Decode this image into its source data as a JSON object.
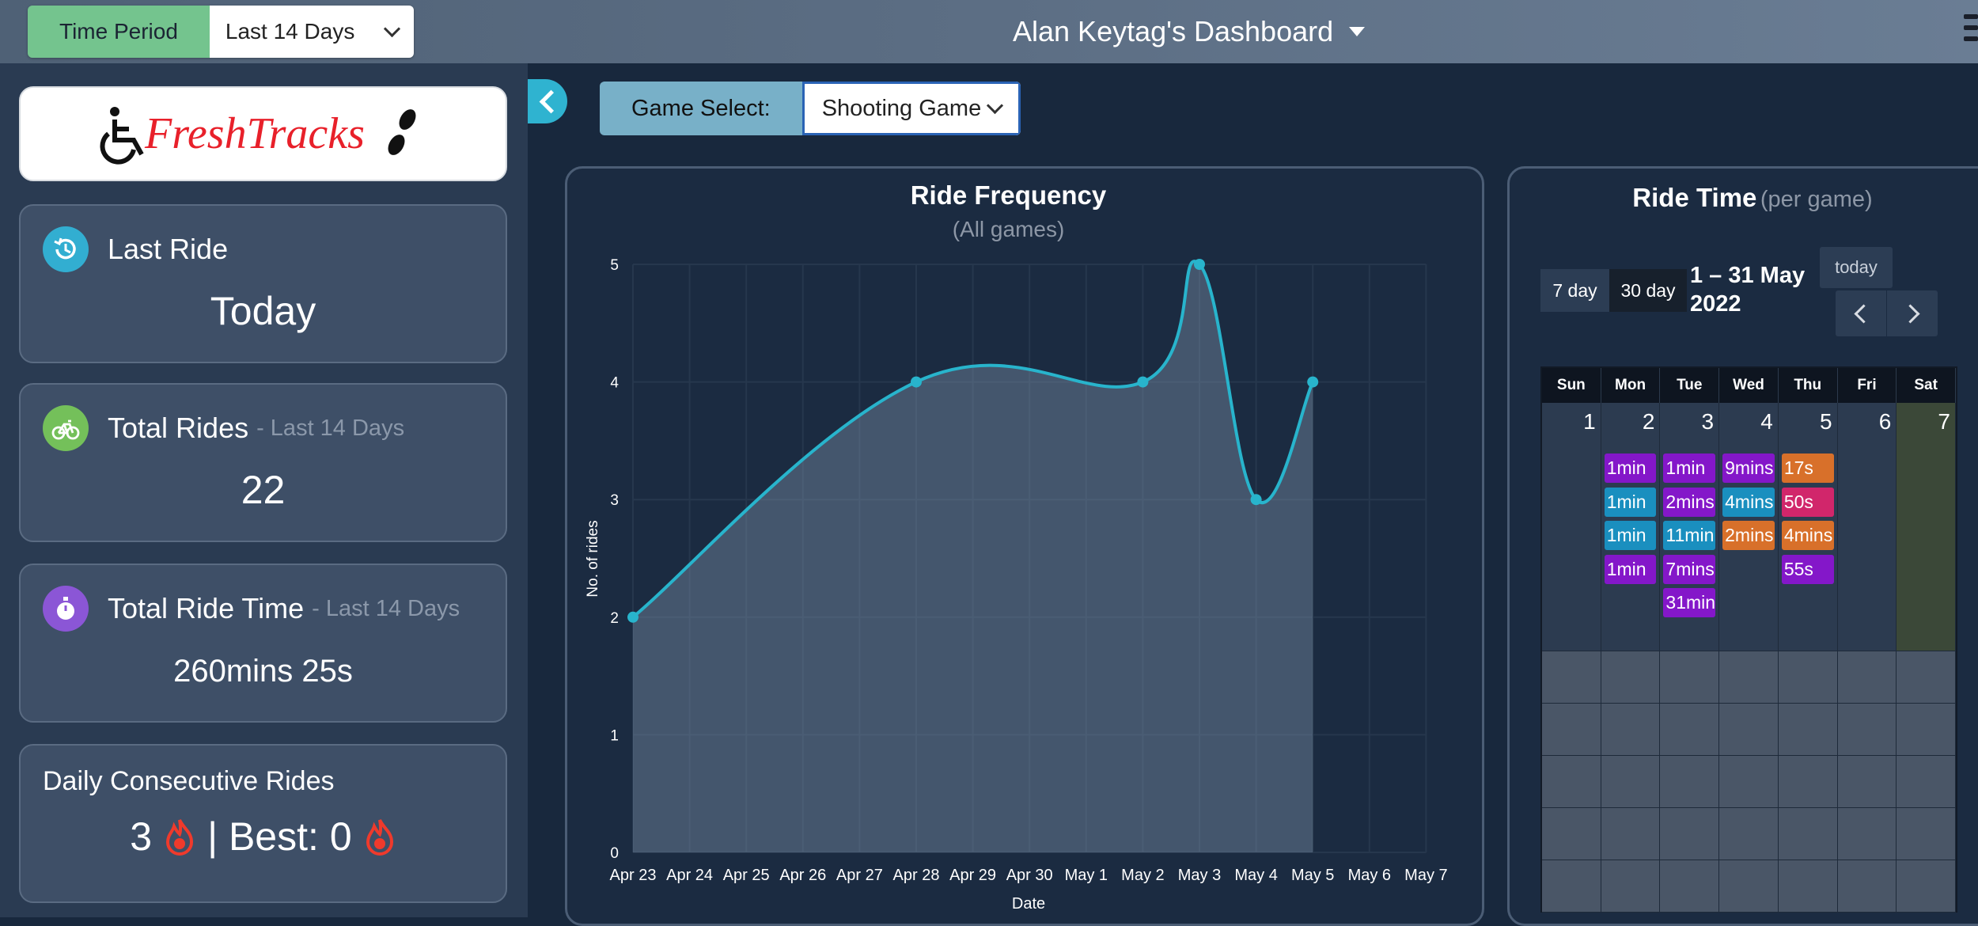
{
  "topbar": {
    "time_period_label": "Time Period",
    "time_period_value": "Last 14 Days",
    "dashboard_title": "Alan Keytag's Dashboard"
  },
  "sidebar": {
    "logo_text": "FreshTracks",
    "last_ride": {
      "label": "Last Ride",
      "value": "Today"
    },
    "total_rides": {
      "label": "Total Rides",
      "sub": "- Last 14 Days",
      "value": "22"
    },
    "total_ride_time": {
      "label": "Total Ride Time",
      "sub": "- Last 14 Days",
      "value": "260mins 25s"
    },
    "consecutive": {
      "label": "Daily Consecutive Rides",
      "current": "3",
      "separator": "| Best:",
      "best": "0"
    }
  },
  "game_select": {
    "label": "Game Select:",
    "value": "Shooting Game"
  },
  "chart_data": {
    "type": "line",
    "title": "Ride Frequency",
    "subtitle": "(All games)",
    "xlabel": "Date",
    "ylabel": "No. of rides",
    "categories": [
      "Apr 23",
      "Apr 24",
      "Apr 25",
      "Apr 26",
      "Apr 27",
      "Apr 28",
      "Apr 29",
      "Apr 30",
      "May 1",
      "May 2",
      "May 3",
      "May 4",
      "May 5",
      "May 6",
      "May 7"
    ],
    "points": [
      {
        "x": "Apr 23",
        "y": 2
      },
      {
        "x": "Apr 28",
        "y": 4
      },
      {
        "x": "May 2",
        "y": 4
      },
      {
        "x": "May 3",
        "y": 5
      },
      {
        "x": "May 4",
        "y": 3
      },
      {
        "x": "May 5",
        "y": 4
      }
    ],
    "ylim": [
      0,
      5
    ],
    "yticks": [
      "0",
      "1",
      "2",
      "3",
      "4",
      "5"
    ],
    "grid": true,
    "line_color": "#28b4cc"
  },
  "ride_time": {
    "title": "Ride Time",
    "subtitle": "(per game)",
    "view_7day": "7 day",
    "view_30day": "30 day",
    "range_line1": "1 – 31 May",
    "range_line2": "2022",
    "today_label": "today",
    "weekdays": [
      "Sun",
      "Mon",
      "Tue",
      "Wed",
      "Thu",
      "Fri",
      "Sat"
    ],
    "days": [
      "1",
      "2",
      "3",
      "4",
      "5",
      "6",
      "7"
    ],
    "events": [
      {
        "day": 1,
        "label": "1min",
        "color": "#8417c9"
      },
      {
        "day": 1,
        "label": "1min",
        "color": "#1a8fbf"
      },
      {
        "day": 1,
        "label": "1min",
        "color": "#1a8fbf"
      },
      {
        "day": 1,
        "label": "1min",
        "color": "#8417c9"
      },
      {
        "day": 2,
        "label": "1min",
        "color": "#8417c9"
      },
      {
        "day": 2,
        "label": "2mins",
        "color": "#8417c9"
      },
      {
        "day": 2,
        "label": "11min",
        "color": "#1a8fbf"
      },
      {
        "day": 2,
        "label": "7mins",
        "color": "#8417c9"
      },
      {
        "day": 2,
        "label": "31min",
        "color": "#8417c9"
      },
      {
        "day": 3,
        "label": "9mins",
        "color": "#8417c9"
      },
      {
        "day": 3,
        "label": "4mins",
        "color": "#1a8fbf"
      },
      {
        "day": 3,
        "label": "2mins",
        "color": "#d8702a"
      },
      {
        "day": 4,
        "label": "17s",
        "color": "#d8702a"
      },
      {
        "day": 4,
        "label": "50s",
        "color": "#d1266b"
      },
      {
        "day": 4,
        "label": "4mins",
        "color": "#d8702a"
      },
      {
        "day": 4,
        "label": "55s",
        "color": "#8417c9"
      }
    ]
  }
}
